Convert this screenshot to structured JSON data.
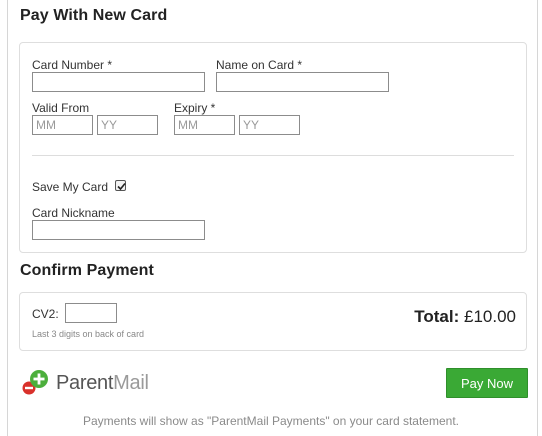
{
  "new_card": {
    "title": "Pay With New Card",
    "card_number_label": "Card Number *",
    "card_number_value": "",
    "name_on_card_label": "Name on Card *",
    "name_on_card_value": "",
    "valid_from_label": "Valid From",
    "valid_from_month_placeholder": "MM",
    "valid_from_year_placeholder": "YY",
    "expiry_label": "Expiry *",
    "expiry_month_placeholder": "MM",
    "expiry_year_placeholder": "YY",
    "save_card_label": "Save My Card",
    "save_card_checked": true,
    "nickname_label": "Card Nickname",
    "nickname_value": ""
  },
  "confirm": {
    "title": "Confirm Payment",
    "cv2_label": "CV2:",
    "cv2_value": "",
    "cv2_hint": "Last 3 digits on back of card",
    "total_label": "Total:",
    "total_value": "£10.00"
  },
  "brand": {
    "logo_text_a": "Parent",
    "logo_text_b": "Mail",
    "logo_icon": "parentmail-logo-icon"
  },
  "actions": {
    "pay_now_label": "Pay Now"
  },
  "footer": {
    "note": "Payments will show as \"ParentMail Payments\" on your card statement."
  },
  "colors": {
    "pay_button": "#3aa935",
    "logo_green": "#4caf3c",
    "logo_red": "#d9312b"
  }
}
